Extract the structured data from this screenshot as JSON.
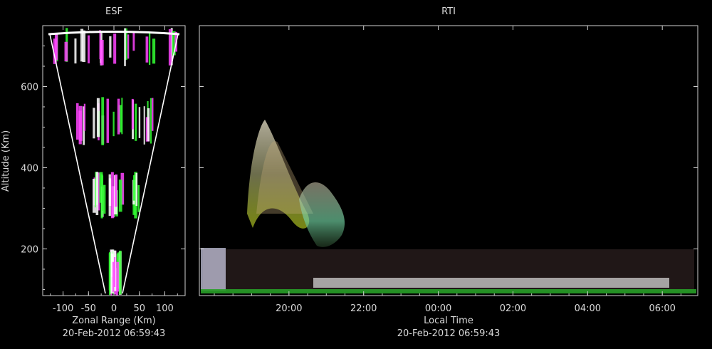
{
  "chart_data": [
    {
      "type": "scatter",
      "title": "ESF",
      "xlabel": "Zonal Range (Km)",
      "ylabel": "Altitude (Km)",
      "xlim": [
        -140,
        140
      ],
      "ylim": [
        85,
        750
      ],
      "x_ticks": [
        -100,
        -50,
        0,
        50,
        100
      ],
      "y_ticks": [
        200,
        400,
        600
      ],
      "timestamp": "20-Feb-2012 06:59:43",
      "echo_bands_altitude_km": [
        [
          85,
          200
        ],
        [
          275,
          390
        ],
        [
          455,
          575
        ],
        [
          650,
          745
        ]
      ],
      "series_colors": [
        "#ff44ff",
        "#33ff33",
        "#ffffff"
      ]
    },
    {
      "type": "heatmap",
      "title": "RTI",
      "xlabel": "Local Time",
      "x_ticks": [
        "20:00",
        "22:00",
        "00:00",
        "02:00",
        "04:00",
        "06:00"
      ],
      "xlim_hours": [
        17.6,
        30.95
      ],
      "ylim": [
        85,
        750
      ],
      "y_ticks": [
        200,
        400,
        600
      ],
      "timestamp": "20-Feb-2012 06:59:43",
      "plume_events": [
        {
          "t_start_hours": 19.3,
          "t_end_hours": 20.9,
          "alt_min_km": 240,
          "alt_max_km": 520
        },
        {
          "t_start_hours": 20.8,
          "t_end_hours": 21.8,
          "alt_min_km": 180,
          "alt_max_km": 340
        }
      ],
      "bottomside_layer_altitude_km": [
        95,
        200
      ]
    }
  ]
}
